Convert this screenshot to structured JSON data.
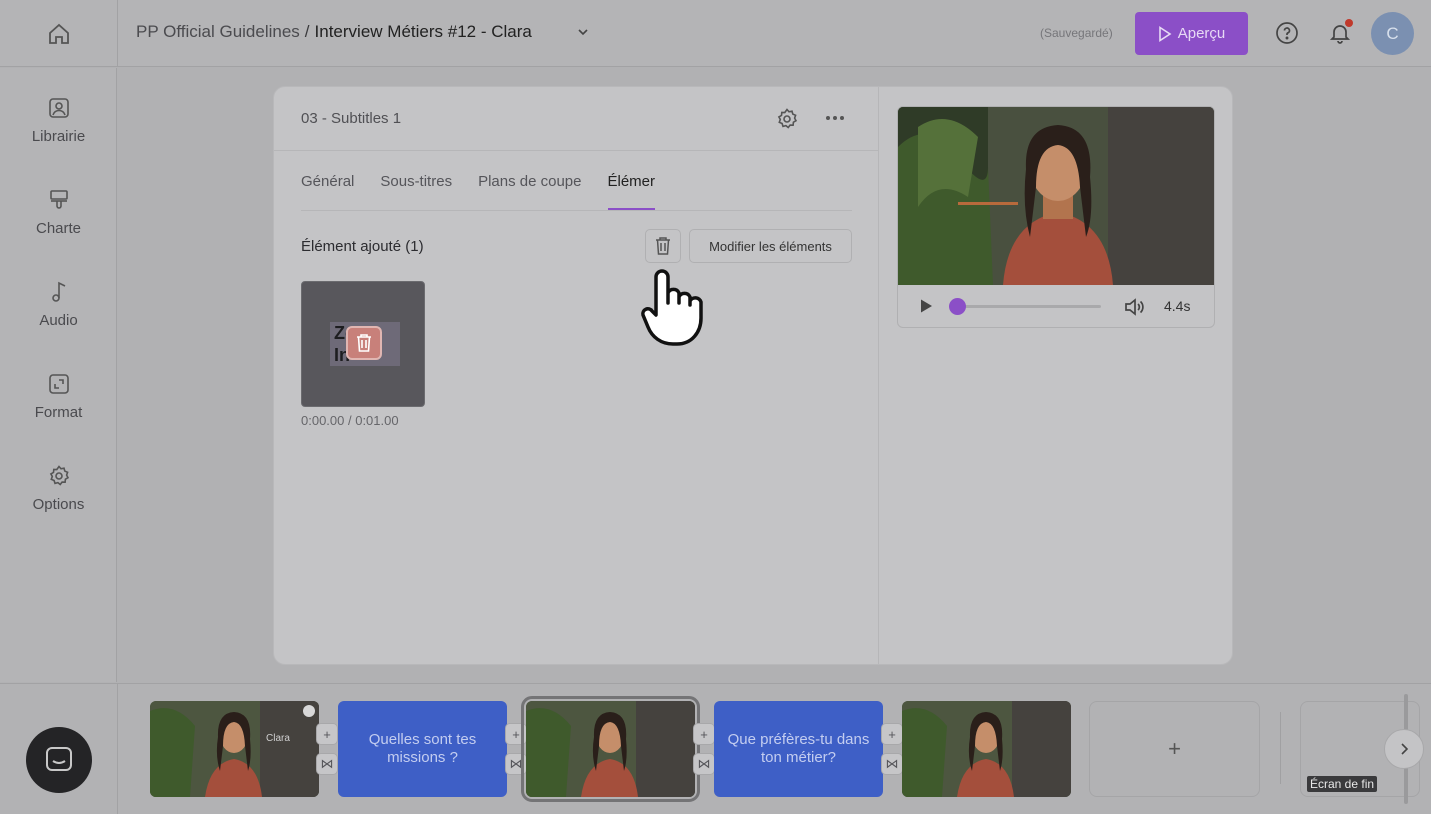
{
  "header": {
    "folder": "PP Official Guidelines",
    "separator": "/",
    "project": "Interview Métiers #12 - Clara",
    "saved_status": "(Sauvegardé)",
    "preview_label": "Aperçu",
    "avatar_initial": "C"
  },
  "sidebar": {
    "items": [
      {
        "label": "Librairie",
        "icon": "image-library-icon"
      },
      {
        "label": "Charte",
        "icon": "paint-brush-icon"
      },
      {
        "label": "Audio",
        "icon": "music-note-icon"
      },
      {
        "label": "Format",
        "icon": "format-resize-icon"
      },
      {
        "label": "Options",
        "icon": "gear-icon"
      }
    ]
  },
  "editor": {
    "title": "03 - Subtitles 1",
    "tabs": [
      {
        "label": "Général",
        "active": false
      },
      {
        "label": "Sous-titres",
        "active": false
      },
      {
        "label": "Plans de coupe",
        "active": false
      },
      {
        "label": "Élémer",
        "active": true
      }
    ],
    "section_label": "Élément ajouté (1)",
    "modify_button": "Modifier les éléments",
    "element": {
      "thumb_text": "Zoom In",
      "time": "0:00.00 / 0:01.00"
    }
  },
  "preview": {
    "duration": "4.4s",
    "progress": 0.03
  },
  "timeline": {
    "clips": [
      {
        "type": "video",
        "label": "Clara"
      },
      {
        "type": "text",
        "label": "Quelles sont tes missions ?"
      },
      {
        "type": "video",
        "label": "",
        "selected": true
      },
      {
        "type": "text",
        "label": "Que préfères-tu dans ton métier?"
      },
      {
        "type": "video",
        "label": ""
      }
    ],
    "connector_add": "+",
    "connector_transition": "⋈",
    "add_clip_label": "+",
    "end_screen_label": "Écran de fin"
  },
  "colors": {
    "accent": "#8b4fc7",
    "text_clip": "#3e5fc6"
  }
}
